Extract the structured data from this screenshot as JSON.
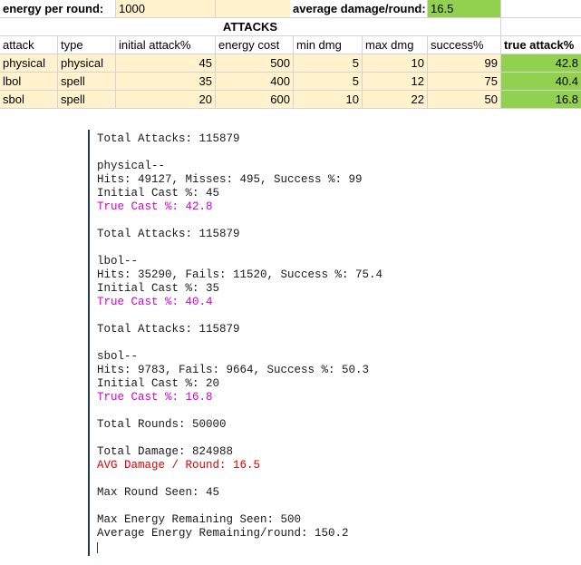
{
  "sheet": {
    "energy_label": "energy per round:",
    "energy_value": "1000",
    "avg_label": "average damage/round:",
    "avg_value": "16.5",
    "section_title": "ATTACKS",
    "headers": [
      "attack",
      "type",
      "initial attack%",
      "energy cost",
      "min dmg",
      "max dmg",
      "success%",
      "true attack%"
    ],
    "rows": [
      [
        "physical",
        "physical",
        "45",
        "500",
        "5",
        "10",
        "99",
        "42.8"
      ],
      [
        "lbol",
        "spell",
        "35",
        "400",
        "5",
        "12",
        "75",
        "40.4"
      ],
      [
        "sbol",
        "spell",
        "20",
        "600",
        "10",
        "22",
        "50",
        "16.8"
      ]
    ]
  },
  "console": {
    "lines": [
      "Total Attacks: 115879",
      "",
      "physical--",
      "Hits: 49127, Misses: 495, Success %: 99",
      "Initial Cast %: 45",
      "True Cast %: 42.8",
      "",
      "Total Attacks: 115879",
      "",
      "lbol--",
      "Hits: 35290, Fails: 11520, Success %: 75.4",
      "Initial Cast %: 35",
      "True Cast %: 40.4",
      "",
      "Total Attacks: 115879",
      "",
      "sbol--",
      "Hits: 9783, Fails: 9664, Success %: 50.3",
      "Initial Cast %: 20",
      "True Cast %: 16.8",
      "",
      "Total Rounds: 50000",
      "",
      "Total Damage: 824988",
      "AVG Damage / Round: 16.5",
      "",
      "Max Round Seen: 45",
      "",
      "Max Energy Remaining Seen: 500",
      "Average Energy Remaining/round: 150.2"
    ],
    "colors": {
      "true_cast": "#d400d4",
      "avg_damage": "#e00000",
      "default": "#1a1a1a"
    }
  }
}
